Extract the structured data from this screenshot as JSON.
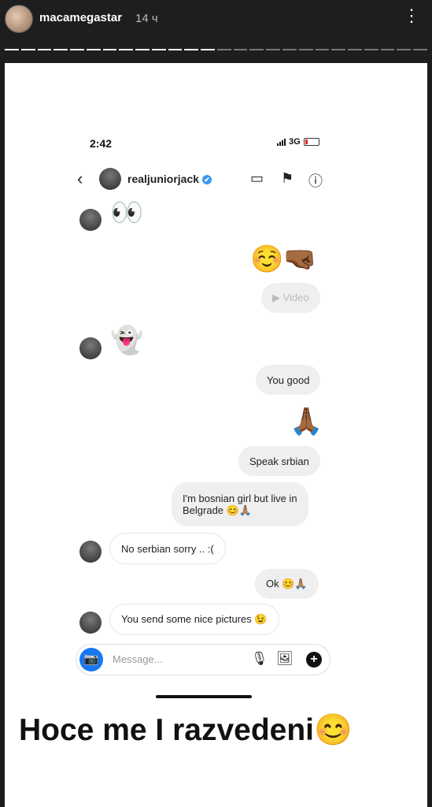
{
  "story": {
    "username": "macamegastar",
    "time": "14 ч",
    "more_icon": "⋮"
  },
  "status_bar": {
    "time": "2:42",
    "network": "3G"
  },
  "chat": {
    "contact": "realjuniorjack",
    "verified_icon": "✔",
    "back_icon": "‹",
    "video_icon": "▭",
    "flag_icon": "⚑",
    "info_icon": "ⓘ",
    "messages": [
      {
        "emoji": "👀"
      },
      {
        "emoji": "☺️🤜🏾"
      },
      {
        "text": "▶ Video"
      },
      {
        "emoji": "👻"
      },
      {
        "text": "You good"
      },
      {
        "emoji": "🙏🏾"
      },
      {
        "text": "Speak srbian"
      },
      {
        "text_line1": "I'm bosnian girl but live in",
        "text_line2": "Belgrade 😊🙏🏽"
      },
      {
        "text": "No serbian sorry .. :("
      },
      {
        "text": "Ok 😊🙏🏽"
      },
      {
        "text": "You send some nice pictures 😉"
      }
    ]
  },
  "composer": {
    "placeholder": "Message...",
    "camera_icon": "📷",
    "mic_icon": "🎙",
    "gallery_icon": "🖼",
    "plus_icon": "+"
  },
  "caption": "Hoce me I razvedeni😊"
}
